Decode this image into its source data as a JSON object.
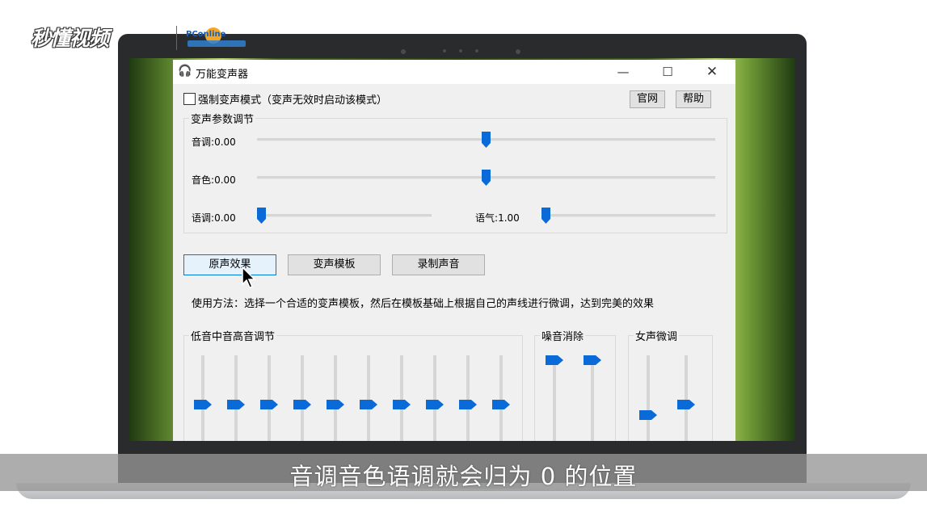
{
  "overlay": {
    "site_logo": "秒懂视频",
    "partner_logo": "PConline"
  },
  "window": {
    "title": "万能变声器",
    "minimize": "—",
    "maximize": "☐",
    "close": "✕"
  },
  "header": {
    "force_mode_label": "强制变声模式（变声无效时启动该模式）",
    "force_mode_checked": false,
    "official_site_button": "官网",
    "help_button": "帮助"
  },
  "voice_params": {
    "group_title": "变声参数调节",
    "pitch": {
      "label": "音调",
      "value": "0.00"
    },
    "timbre": {
      "label": "音色",
      "value": "0.00"
    },
    "intonation": {
      "label": "语调",
      "value": "0.00"
    },
    "breath": {
      "label": "语气",
      "value": "1.00"
    }
  },
  "actions": {
    "original_voice": "原声效果",
    "voice_template": "变声模板",
    "record_voice": "录制声音"
  },
  "usage_text": "使用方法：选择一个合适的变声模板，然后在模板基础上根据自己的声线进行微调，达到完美的效果",
  "equalizer": {
    "group_title": "低音中音高音调节",
    "band_count": 10
  },
  "noise_reduction": {
    "group_title": "噪音消除",
    "slider_count": 2
  },
  "female_tuning": {
    "group_title": "女声微调",
    "slider_count": 2
  },
  "subtitle": "音调音色语调就会归为 0 的位置",
  "colors": {
    "slider_thumb": "#0a6ad8",
    "selected_button_border": "#0078d7",
    "selected_button_fill": "#e5f1fb"
  }
}
